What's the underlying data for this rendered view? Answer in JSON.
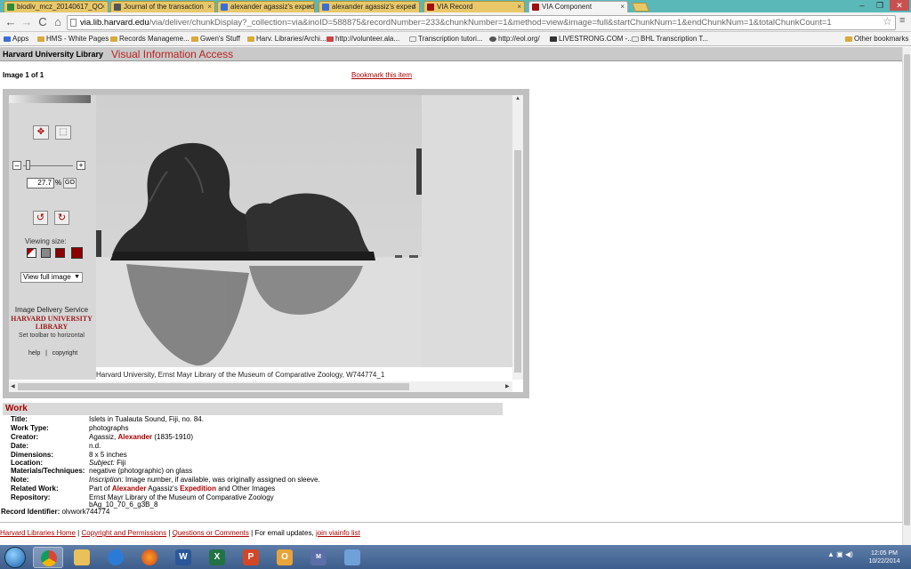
{
  "browser": {
    "tabs": [
      {
        "label": "biodiv_mcz_20140617_QC",
        "active": false,
        "color": "#2e8b3a"
      },
      {
        "label": "Journal of the transaction",
        "active": false,
        "color": "#555555"
      },
      {
        "label": "alexander agassiz's exped",
        "active": false,
        "color": "#3b6fd6"
      },
      {
        "label": "alexander agassiz's exped",
        "active": false,
        "color": "#3b6fd6"
      },
      {
        "label": "VIA Record",
        "active": false,
        "color": "#a01010"
      },
      {
        "label": "VIA Component",
        "active": true,
        "color": "#a01010"
      }
    ],
    "tab_close": "×",
    "window_controls": {
      "minimize": "–",
      "restore": "❐",
      "close": "✕"
    },
    "nav": {
      "back": "←",
      "forward": "→",
      "reload": "C",
      "home": "⌂"
    },
    "url_host": "via.lib.harvard.edu",
    "url_rest": "/via/deliver/chunkDisplay?_collection=via&inoID=588875&recordNumber=233&chunkNumber=1&method=view&image=full&startChunkNum=1&endChunkNum=1&totalChunkCount=1",
    "star": "☆",
    "menu": "≡",
    "bookmarks": [
      "Apps",
      "HMS - White Pages",
      "Records Manageme...",
      "Gwen's Stuff",
      "Harv. Libraries/Archi...",
      "http://volunteer.ala...",
      "Transcription tutori...",
      "http://eol.org/",
      "LIVESTRONG.COM -...",
      "BHL Transcription T..."
    ],
    "other_bookmarks": "Other bookmarks"
  },
  "site": {
    "library_name": "Harvard University Library",
    "app_title": "Visual Information Access",
    "image_count": "Image 1 of 1",
    "bookmark_link": "Bookmark this item"
  },
  "viewer": {
    "zoom_minus": "–",
    "zoom_plus": "+",
    "zoom_value": "27.7",
    "zoom_unit": "%",
    "go_label": "GO",
    "viewing_size_label": "Viewing size:",
    "view_select": "View full image",
    "service_label": "Image Delivery Service",
    "library_logo_text": "HARVARD UNIVERSITY LIBRARY",
    "toolbar_toggle": "Set toolbar to horizontal",
    "help_label": "help",
    "separator": "|",
    "copyright_label": "copyright",
    "credit": "Harvard University, Ernst Mayr Library of the Museum of Comparative Zoology, W744774_1"
  },
  "record": {
    "section_title": "Work",
    "fields": {
      "title_label": "Title:",
      "title": "Islets in Tualauta Sound, Fiji, no. 84.",
      "worktype_label": "Work Type:",
      "worktype": "photographs",
      "creator_label": "Creator:",
      "creator_pre": "Agassiz,",
      "creator_hl": "Alexander",
      "creator_post": "(1835-1910)",
      "date_label": "Date:",
      "date": "n.d.",
      "dimensions_label": "Dimensions:",
      "dimensions": "8 x 5 inches",
      "location_label": "Location:",
      "location_pre": "Subject:",
      "location": "Fiji",
      "materials_label": "Materials/Techniques:",
      "materials": "negative (photographic) on glass",
      "note_label": "Note:",
      "note_pre": "Inscription:",
      "note": "Image number, if available, was originally assigned on sleeve.",
      "related_label": "Related Work:",
      "related_pre": "Part of",
      "related_hl1": "Alexander",
      "related_mid": "Agassiz's",
      "related_hl2": "Expedition",
      "related_post": "and Other Images",
      "repository_label": "Repository:",
      "repository": "Ernst Mayr Library of the Museum of Comparative Zoology",
      "repository_id": "bAg_10_70_6_g3B_8"
    },
    "record_id_label": "Record Identifier:",
    "record_id": "olvwork744774"
  },
  "footer": {
    "links": [
      "Harvard Libraries Home",
      "Copyright and Permissions",
      "Questions or Comments"
    ],
    "separator": "|",
    "email_text": "For email updates,",
    "email_link": "join viainfo list"
  },
  "taskbar": {
    "time": "12:05 PM",
    "date": "10/22/2014",
    "apps": [
      "chrome",
      "explorer",
      "internet-explorer",
      "firefox",
      "word",
      "excel",
      "powerpoint",
      "outlook",
      "marc",
      "network"
    ],
    "app_glyphs": {
      "word": "W",
      "excel": "X",
      "powerpoint": "P",
      "outlook": "O",
      "marc": "M"
    }
  },
  "colors": {
    "accent": "#a00000",
    "tab": "#e9c86a",
    "tabstrip": "#5bb8b8"
  }
}
